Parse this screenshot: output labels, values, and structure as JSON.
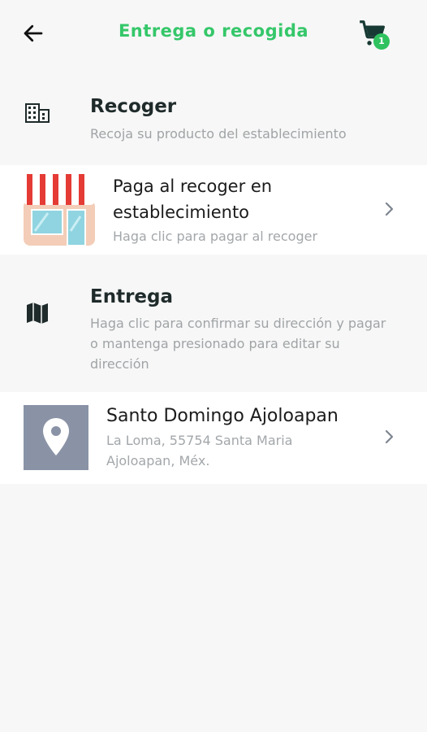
{
  "header": {
    "title": "Entrega o recogida",
    "cart_count": "1"
  },
  "pickup": {
    "title": "Recoger",
    "subtitle": "Recoja su producto del establecimiento",
    "option": {
      "title_line1": "Paga al recoger en",
      "title_line2": "establecimiento",
      "subtitle": "Haga clic para pagar al recoger"
    }
  },
  "delivery": {
    "title": "Entrega",
    "subtitle_line1": "Haga clic para confirmar su dirección y pagar",
    "subtitle_line2": "o mantenga presionado para editar su",
    "subtitle_line3": "dirección",
    "address": {
      "name": "Santo Domingo Ajoloapan",
      "line1": "La Loma, 55754 Santa Maria",
      "line2": "Ajoloapan, Méx."
    }
  },
  "colors": {
    "accent": "#35c76a",
    "background": "#f7f7f7",
    "card": "#ffffff",
    "location_tile": "#8a93a6"
  }
}
